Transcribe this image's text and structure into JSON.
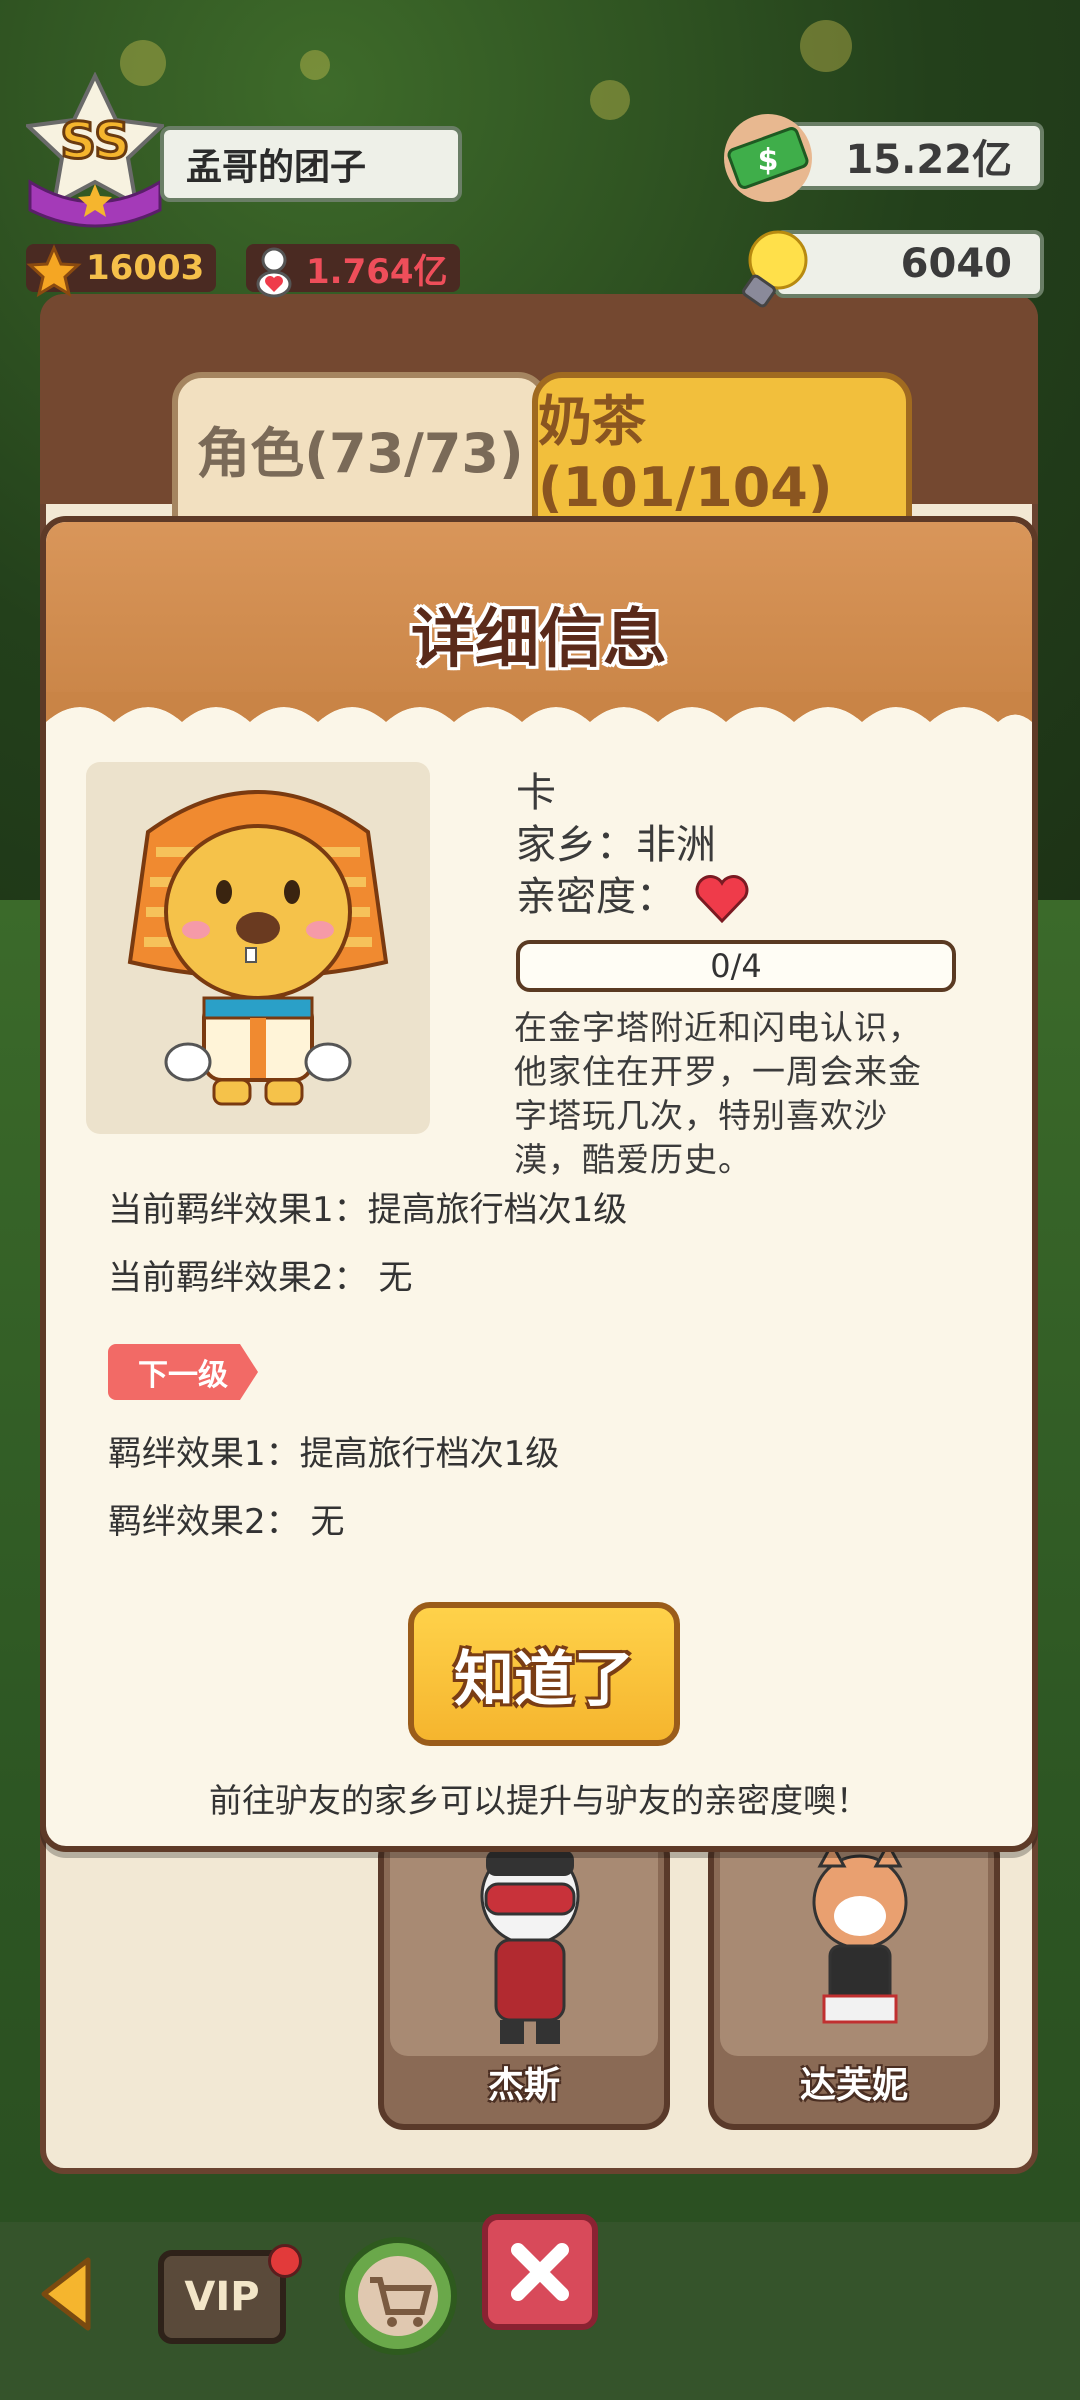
{
  "player": {
    "rank": "SS",
    "name": "孟哥的团子",
    "stars": "16003",
    "fans": "1.764亿"
  },
  "currency": {
    "cash": "15.22亿",
    "ideas": "6040"
  },
  "tabs": [
    {
      "label": "角色(73/73)"
    },
    {
      "label": "奶茶(101/104)"
    }
  ],
  "modal": {
    "title": "详细信息",
    "character": {
      "name": "卡",
      "hometown": "家乡：非洲",
      "intimacy_label": "亲密度：",
      "progress_text": "0/4",
      "progress_value": 0,
      "bio_lines": [
        "在金字塔附近和闪电认识，",
        "他家住在开罗，一周会来金",
        "字塔玩几次，特别喜欢沙",
        "漠，酷爱历史。"
      ]
    },
    "current_effect_1": "当前羁绊效果1：提高旅行档次1级",
    "current_effect_2": "当前羁绊效果2： 无",
    "next_level_tag": "下一级",
    "next_effect_1": "羁绊效果1：提高旅行档次1级",
    "next_effect_2": "羁绊效果2： 无",
    "ok_button": "知道了",
    "hint": "前往驴友的家乡可以提升与驴友的亲密度噢！"
  },
  "cards": [
    {
      "name": "杰斯"
    },
    {
      "name": "达芙妮"
    }
  ],
  "bottom_nav": {
    "vip_label": "VIP"
  },
  "colors": {
    "accent_gold": "#f5b52e",
    "header_brown": "#c98446",
    "heart_red": "#ef3b4a",
    "next_tag_red": "#f26a66"
  }
}
